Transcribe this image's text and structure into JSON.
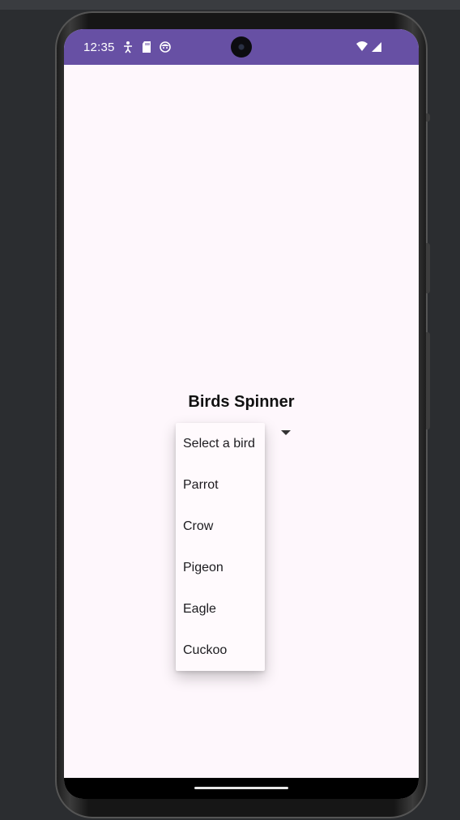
{
  "status_bar": {
    "time": "12:35",
    "icons_left": [
      "accessibility-icon",
      "sd-card-icon",
      "face-icon"
    ],
    "icons_right": [
      "wifi-icon",
      "signal-icon"
    ],
    "background": "#6750a4"
  },
  "app": {
    "title": "Birds Spinner",
    "background": "#fef7fc"
  },
  "spinner": {
    "options": [
      "Select a bird",
      "Parrot",
      "Crow",
      "Pigeon",
      "Eagle",
      "Cuckoo"
    ]
  }
}
